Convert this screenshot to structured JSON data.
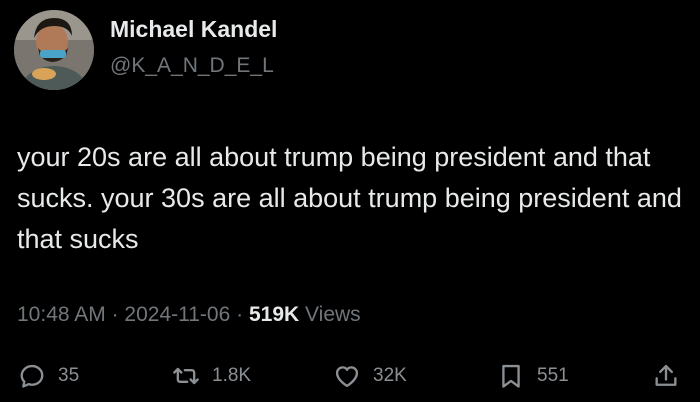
{
  "author": {
    "name": "Michael Kandel",
    "handle": "@K_A_N_D_E_L"
  },
  "tweet": {
    "text": "your 20s are all about trump being president and that sucks. your 30s are all about trump being president and that sucks",
    "time": "10:48 AM",
    "separator": "·",
    "date": "2024-11-06",
    "views_count": "519K",
    "views_label": "Views"
  },
  "actions": {
    "replies": "35",
    "reposts": "1.8K",
    "likes": "32K",
    "bookmarks": "551"
  },
  "icons": {
    "reply": "reply-icon",
    "repost": "repost-icon",
    "like": "heart-icon",
    "bookmark": "bookmark-icon",
    "share": "share-icon"
  },
  "colors": {
    "background": "#000000",
    "primary_text": "#e7e9ea",
    "secondary_text": "#71767b"
  }
}
